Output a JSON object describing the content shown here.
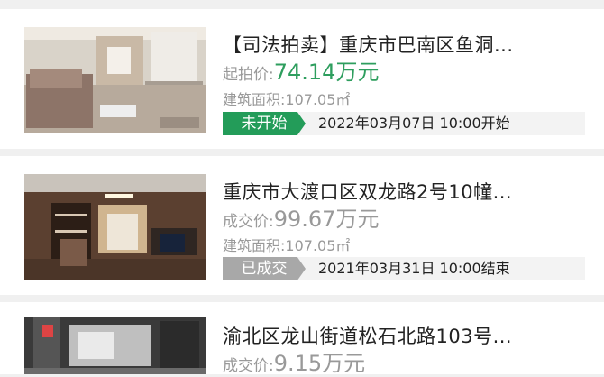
{
  "listings": [
    {
      "title": "【司法拍卖】重庆市巴南区鱼洞...",
      "price_label": "起拍价:",
      "price_value": "74.14万元",
      "area_label": "建筑面积:",
      "area_value": "107.05㎡",
      "status": "未开始",
      "status_time": "2022年03月07日 10:00开始",
      "price_color": "#2e9e5e",
      "badge_color": "#239c59"
    },
    {
      "title": "重庆市大渡口区双龙路2号10幢...",
      "price_label": "成交价:",
      "price_value": "99.67万元",
      "area_label": "建筑面积:",
      "area_value": "107.05㎡",
      "status": "已成交",
      "status_time": "2021年03月31日 10:00结束",
      "price_color": "#999999",
      "badge_color": "#a8a8a8"
    },
    {
      "title": "渝北区龙山街道松石北路103号...",
      "price_label": "成交价:",
      "price_value": "9.15万元",
      "price_color": "#999999"
    }
  ]
}
